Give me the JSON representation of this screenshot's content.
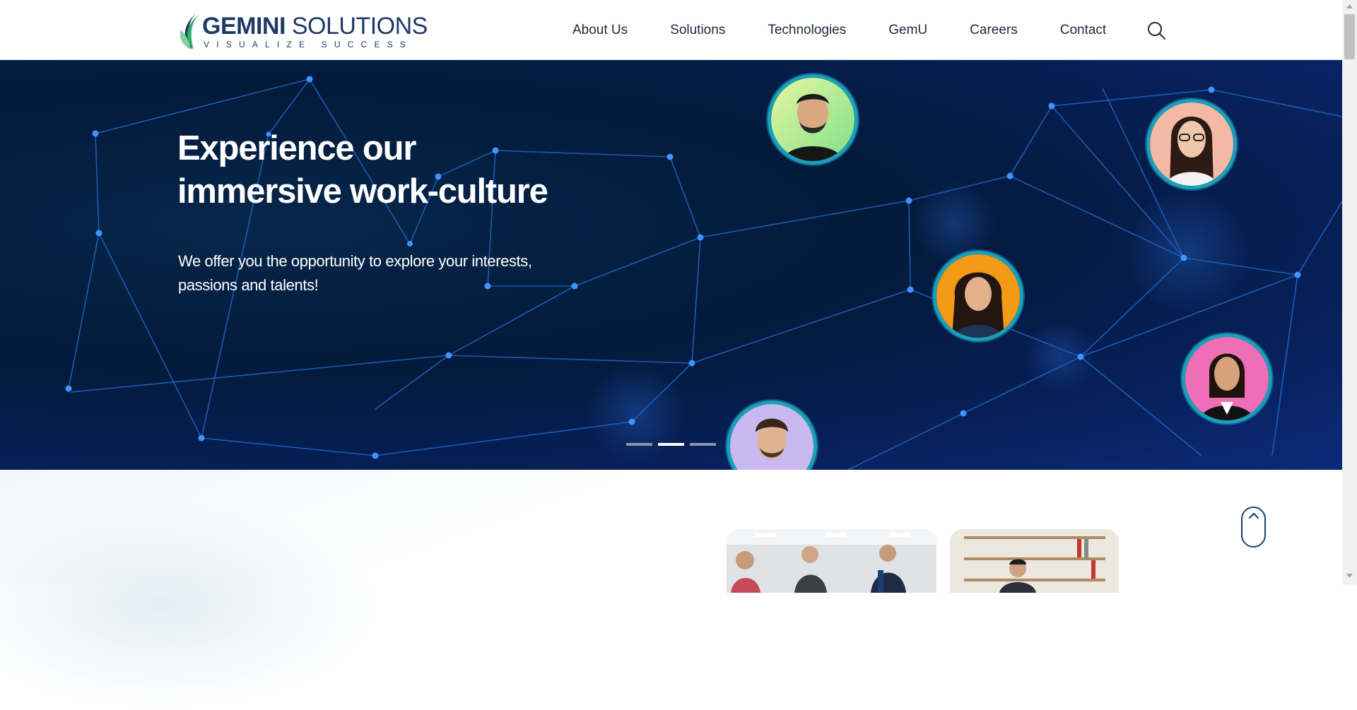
{
  "header": {
    "logo": {
      "word_bold": "GEMINI",
      "word_light": " SOLUTIONS",
      "tagline": "VISUALIZE SUCCESS"
    },
    "nav": [
      "About Us",
      "Solutions",
      "Technologies",
      "GemU",
      "Careers",
      "Contact"
    ]
  },
  "hero": {
    "title": "Experience our\nimmersive work-culture",
    "subtitle": "We offer you the opportunity to explore your interests, passions and talents!",
    "slides": 3,
    "active_slide": 2
  },
  "colors": {
    "brand_navy": "#1e3a66",
    "hero_bg": "#031a3a",
    "network_line": "#1e66c8",
    "avatar_ring": "#1aa0b8",
    "leaf_green": "#2fae6a"
  }
}
